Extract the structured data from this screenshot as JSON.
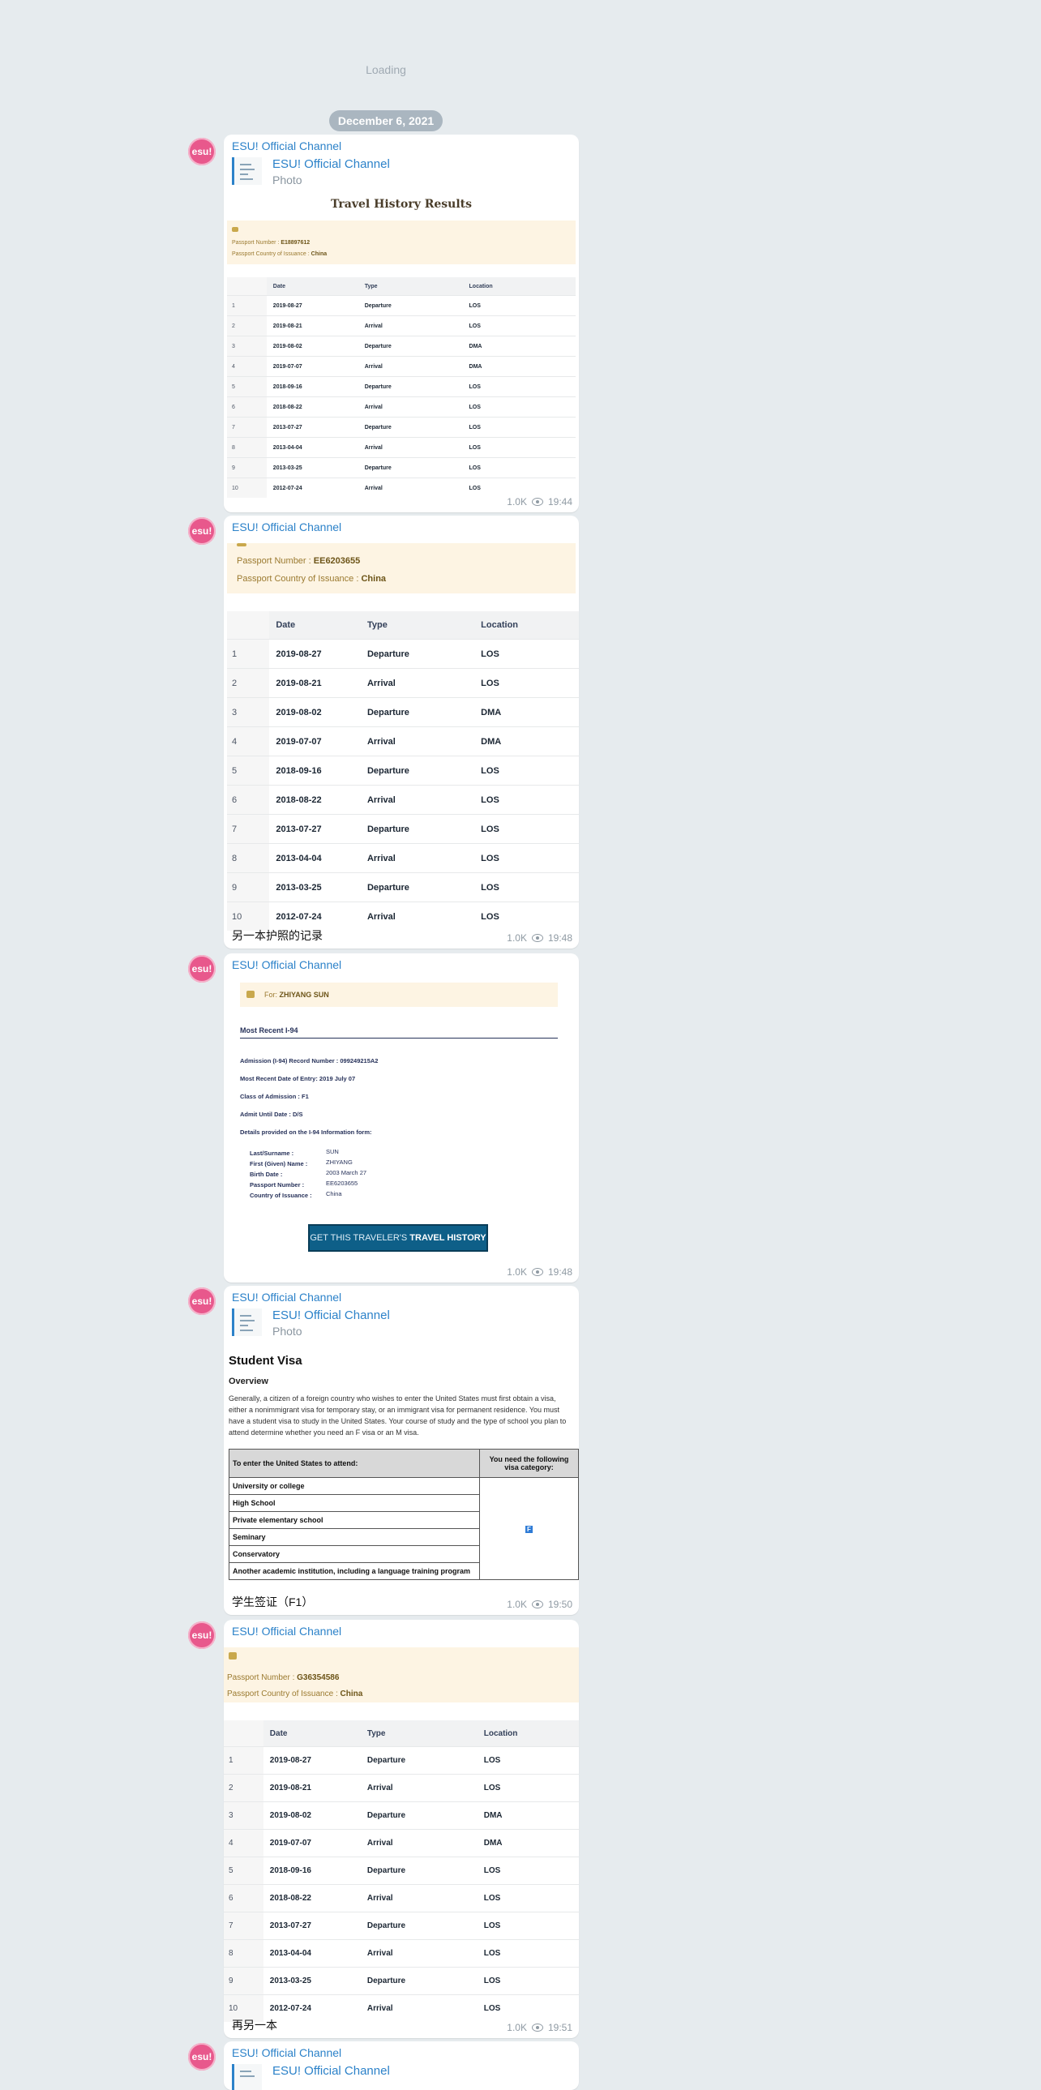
{
  "loading": "Loading",
  "date_separator": "December 6, 2021",
  "avatar_text": "esu!",
  "channel_name": "ESU! Official Channel",
  "views": "1.0K",
  "photo_label": "Photo",
  "history_headers": [
    "Date",
    "Type",
    "Location"
  ],
  "history_rows": [
    [
      "1",
      "2019-08-27",
      "Departure",
      "LOS"
    ],
    [
      "2",
      "2019-08-21",
      "Arrival",
      "LOS"
    ],
    [
      "3",
      "2019-08-02",
      "Departure",
      "DMA"
    ],
    [
      "4",
      "2019-07-07",
      "Arrival",
      "DMA"
    ],
    [
      "5",
      "2018-09-16",
      "Departure",
      "LOS"
    ],
    [
      "6",
      "2018-08-22",
      "Arrival",
      "LOS"
    ],
    [
      "7",
      "2013-07-27",
      "Departure",
      "LOS"
    ],
    [
      "8",
      "2013-04-04",
      "Arrival",
      "LOS"
    ],
    [
      "9",
      "2013-03-25",
      "Departure",
      "LOS"
    ],
    [
      "10",
      "2012-07-24",
      "Arrival",
      "LOS"
    ]
  ],
  "posts": {
    "p1": {
      "time": "19:44",
      "title": "Travel History Results",
      "passport_label": "Passport Number : ",
      "passport_value": "E18897612",
      "country_label": "Passport Country of Issuance : ",
      "country_value": "China"
    },
    "p2": {
      "time": "19:48",
      "caption": "另一本护照的记录",
      "passport_label": "Passport Number : ",
      "passport_value": "EE6203655",
      "country_label": "Passport Country of Issuance : ",
      "country_value": "China"
    },
    "p3": {
      "time": "19:48",
      "for_label": "For: ",
      "for_value": "ZHIYANG SUN",
      "section": "Most Recent I-94",
      "lines": [
        "Admission (I-94) Record Number : 099249215A2",
        "Most Recent Date of Entry: 2019 July 07",
        "Class of Admission : F1",
        "Admit Until Date : D/S",
        "Details provided on the I-94 Information form:"
      ],
      "detail_labels": [
        "Last/Surname :",
        "First (Given) Name :",
        "Birth Date :",
        "Passport Number :",
        "Country of Issuance :"
      ],
      "detail_values": [
        "SUN",
        "ZHIYANG",
        "2003 March 27",
        "EE6203655",
        "China"
      ],
      "button_prefix": "GET THIS TRAVELER'S ",
      "button_bold": "TRAVEL HISTORY"
    },
    "p4": {
      "time": "19:50",
      "caption": "学生签证（F1）",
      "heading": "Student Visa",
      "subheading": "Overview",
      "paragraph": "Generally, a citizen of a foreign country who wishes to enter the United States must first obtain a visa, either a nonimmigrant visa for temporary stay, or an immigrant visa for permanent residence. You must have a student visa to study in the United States. Your course of study and the type of school you plan to attend determine whether you need an F visa or an M visa.",
      "table_h1": "To enter the United States to attend:",
      "table_h2": "You need the following visa category:",
      "table_rows": [
        "University or college",
        "High School",
        "Private elementary school",
        "Seminary",
        "Conservatory",
        "Another academic institution, including a language training program"
      ],
      "visa_mark": "F"
    },
    "p5": {
      "time": "19:51",
      "caption": "再另一本",
      "passport_label": "Passport Number : ",
      "passport_value": "G36354586",
      "country_label": "Passport Country of Issuance : ",
      "country_value": "China"
    }
  },
  "colors": {
    "link": "#2c82c9",
    "avatar": "#e8588c",
    "background": "#e6ebee"
  }
}
